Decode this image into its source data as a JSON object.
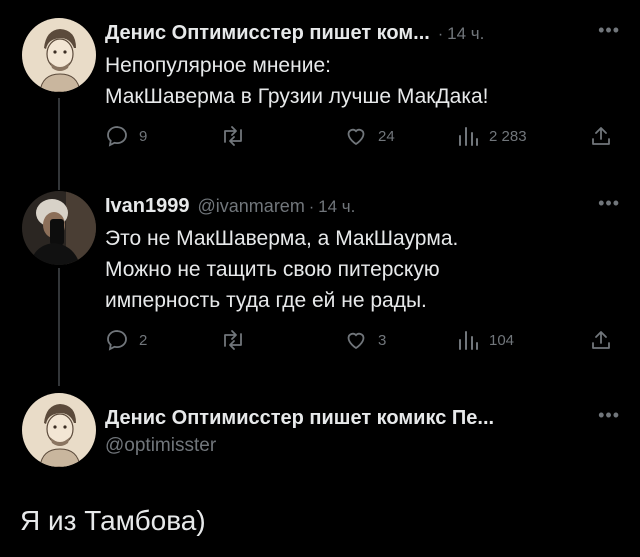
{
  "tweet1": {
    "author": "Денис Оптимисстер пишет ком...",
    "sep": "·",
    "time": "14 ч.",
    "text_lines": [
      "Непопулярное мнение:",
      "МакШаверма в Грузии лучше МакДака!"
    ],
    "replies": "9",
    "retweets": "",
    "likes": "24",
    "views": "2 283"
  },
  "tweet2": {
    "author": "Ivan1999",
    "handle": "@ivanmarem",
    "sep": "·",
    "time": "14 ч.",
    "text_lines": [
      "Это не МакШаверма, а МакШаурма.",
      "Можно не тащить свою питерскую",
      "имперность туда где ей не рады."
    ],
    "replies": "2",
    "retweets": "",
    "likes": "3",
    "views": "104"
  },
  "tweet3": {
    "author": "Денис Оптимисстер пишет комикс Пе...",
    "handle": "@optimisster",
    "text": "Я из Тамбова)"
  },
  "icons": {
    "reply": "reply-icon",
    "retweet": "retweet-icon",
    "like": "heart-icon",
    "views": "views-icon",
    "share": "share-icon",
    "more": "more-icon"
  },
  "colors": {
    "background": "#000000",
    "text": "#e7e9ea",
    "muted": "#71767b",
    "line": "#333639"
  }
}
